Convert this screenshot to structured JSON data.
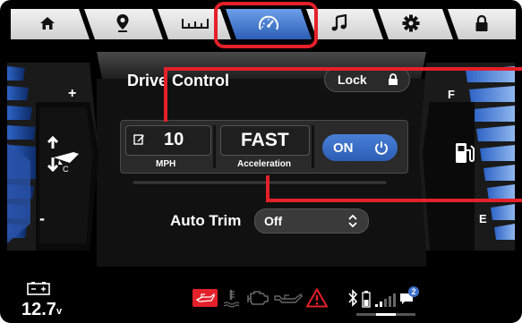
{
  "nav": {
    "tabs": [
      {
        "icon": "home-icon"
      },
      {
        "icon": "location-pin-icon"
      },
      {
        "icon": "ruler-icon"
      },
      {
        "icon": "speedometer-icon",
        "selected": true
      },
      {
        "icon": "music-note-icon"
      },
      {
        "icon": "gear-icon"
      },
      {
        "icon": "lock-icon"
      }
    ]
  },
  "trim": {
    "plus": "+",
    "minus": "-",
    "icon": "boat-trim-icon"
  },
  "fuel": {
    "full": "F",
    "empty": "E",
    "icon": "fuel-pump-icon"
  },
  "drive_control": {
    "title": "Drive Control",
    "lock_label": "Lock",
    "speed_value": "10",
    "speed_unit": "MPH",
    "accel_value": "FAST",
    "accel_label": "Acceleration",
    "toggle_label": "ON"
  },
  "auto_trim": {
    "label": "Auto Trim",
    "value": "Off"
  },
  "status": {
    "battery_value": "12.7",
    "battery_unit": "v",
    "warning_icons": [
      "oil-can-icon",
      "coolant-temp-icon",
      "engine-check-icon",
      "oil-pressure-icon",
      "warning-triangle-icon"
    ],
    "notification_count": "2"
  },
  "colors": {
    "accent": "#3a6fc8",
    "highlight": "#e4202a",
    "tab": "#e8e8e8"
  }
}
